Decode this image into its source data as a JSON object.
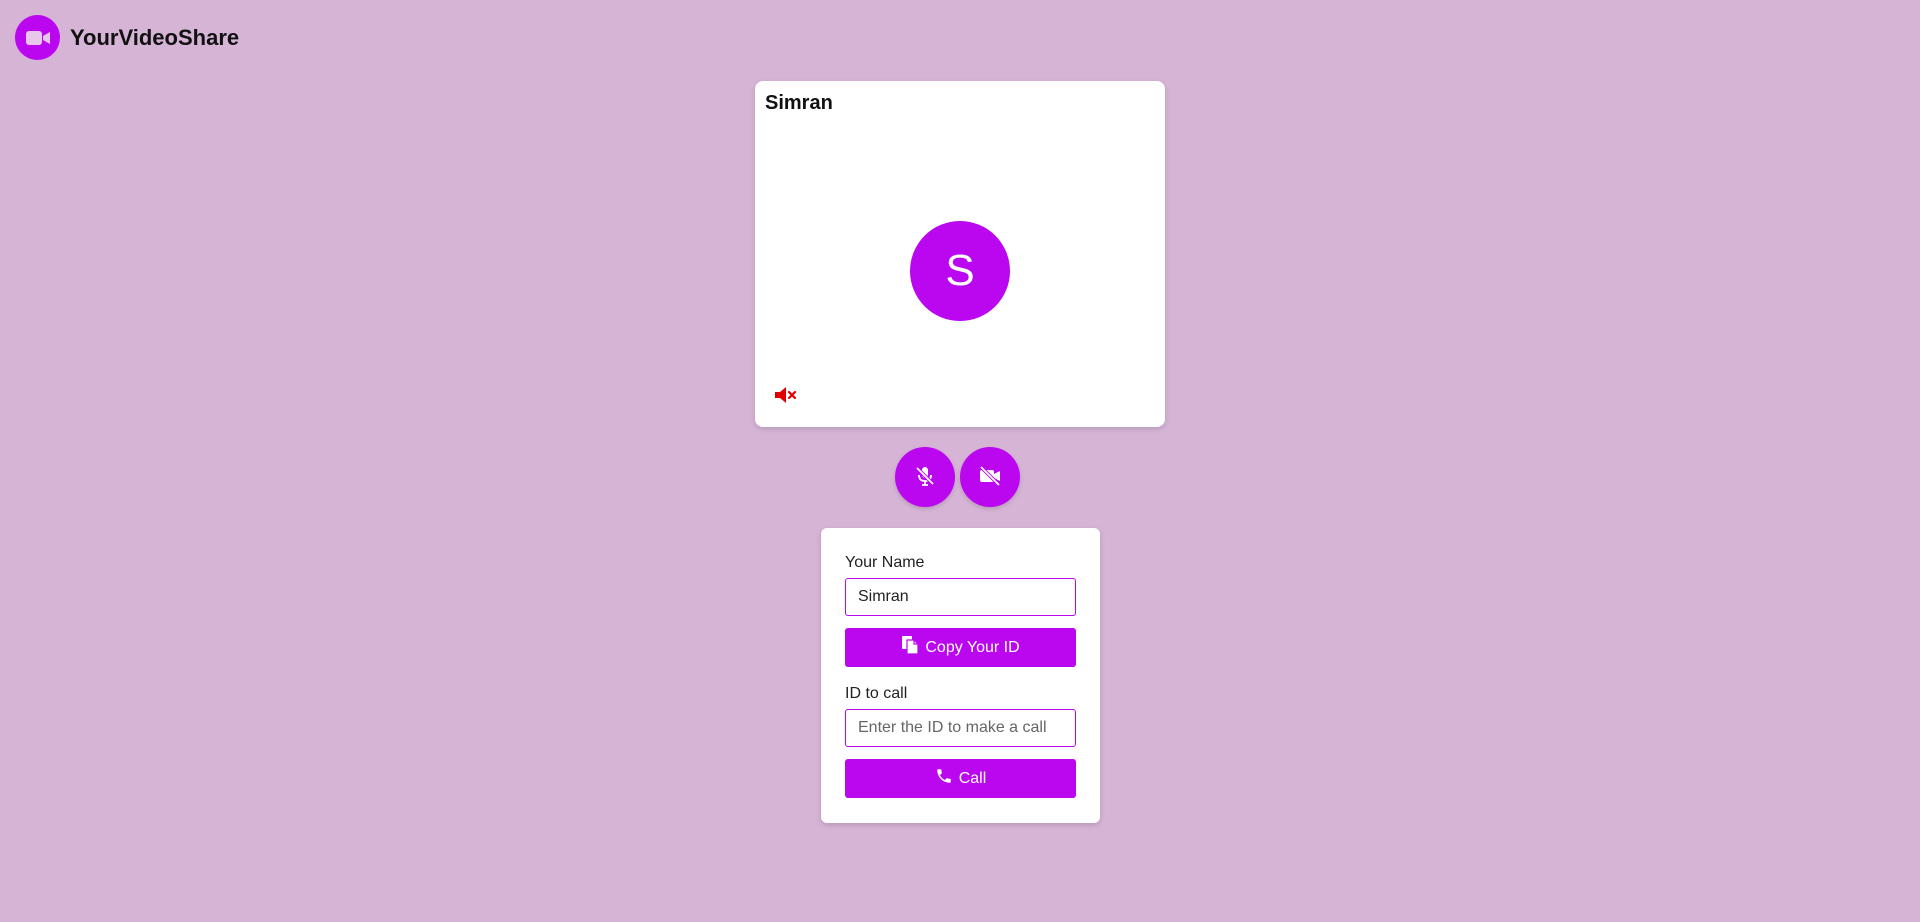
{
  "app": {
    "title": "YourVideoShare",
    "logo_icon": "video-camera-icon"
  },
  "video": {
    "name": "Simran",
    "avatar_initial": "S",
    "audio_status_icon": "speaker-muted-icon"
  },
  "controls": {
    "mic_icon": "mic-off-icon",
    "camera_icon": "video-off-icon"
  },
  "form": {
    "name_label": "Your Name",
    "name_value": "Simran",
    "copy_button_label": "Copy Your ID",
    "call_id_label": "ID to call",
    "call_id_placeholder": "Enter the ID to make a call",
    "call_button_label": "Call"
  },
  "colors": {
    "accent": "#bb06f0",
    "background": "#d6b4d6",
    "muted_red": "#e00000"
  }
}
